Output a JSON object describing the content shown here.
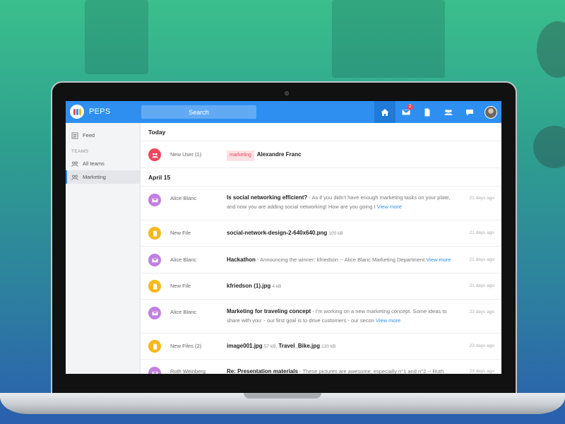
{
  "app": {
    "title": "PEPS"
  },
  "search": {
    "placeholder": "Search"
  },
  "nav": {
    "mail_badge": "2"
  },
  "sidebar": {
    "feed_label": "Feed",
    "teams_heading": "TEAMS",
    "teams": [
      {
        "label": "All teams"
      },
      {
        "label": "Marketing"
      }
    ]
  },
  "feed": {
    "groups": [
      {
        "heading": "Today"
      },
      {
        "heading": "April 15"
      }
    ],
    "today": {
      "actor": "New User (1)",
      "tag": "marketing",
      "title": "Alexandre Franc"
    },
    "rows": [
      {
        "actor": "Alice Blanc",
        "title": "Is social networking efficient?",
        "text": " - As if you didn't have enough marketing tasks on your plate, and now you are adding social networking! How are you going t ",
        "more": "View more",
        "time": "21 days ago"
      },
      {
        "actor": "New File",
        "title": "social-network-design-2-640x640.png",
        "size": "100 kB",
        "time": "21 days ago"
      },
      {
        "actor": "Alice Blanc",
        "title": "Hackathon",
        "text": " - Announcing the winner: kfriedson -- Alice Blanc Marketing Department ",
        "more": "View more",
        "time": "21 days ago"
      },
      {
        "actor": "New File",
        "title": "kfriedson (1).jpg",
        "size": "4 kB",
        "time": "21 days ago"
      },
      {
        "actor": "Alice Blanc",
        "title": "Marketing for traveling concept",
        "text": " - I'm working on a new marketing concept. Some ideas to share with you: - our first goal is to drive customers - our secon ",
        "more": "View more",
        "time": "23 days ago"
      },
      {
        "actor": "New Files (2)",
        "title": "image001.jpg",
        "size": "57 kB,",
        "title2": "Travel_Bike.jpg",
        "size2": "120 kB",
        "time": "23 days ago"
      },
      {
        "actor": "Ruth Weinberg",
        "title": "Re: Presentation materials",
        "text": " - These pictures are awesome, especially n°1 and n°2 -- Ruth",
        "time": "23 days ago"
      }
    ]
  },
  "colors": {
    "accent": "#2e8ff0",
    "mail_icon": "#c27fe0",
    "file_icon": "#f7b81c",
    "user_icon": "#f0475c"
  }
}
